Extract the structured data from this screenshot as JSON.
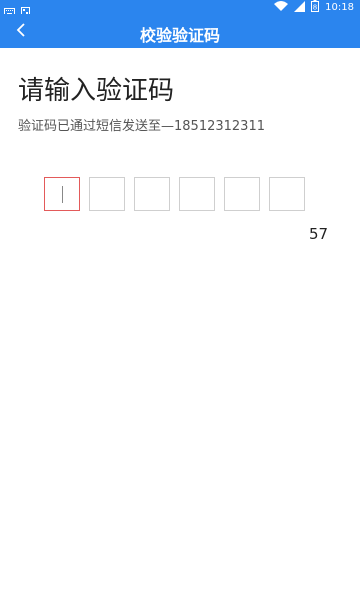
{
  "status_bar": {
    "time": "10:18",
    "battery_level": "8"
  },
  "app_bar": {
    "title": "校验验证码",
    "back_icon": "chevron-left-icon"
  },
  "page": {
    "heading": "请输入验证码",
    "subtitle": "验证码已通过短信发送至—18512312311"
  },
  "code_input": {
    "length": 6,
    "digits": [
      "",
      "",
      "",
      "",
      "",
      ""
    ],
    "active_index": 0
  },
  "countdown": "57",
  "colors": {
    "primary": "#2b85ee",
    "active_border": "#e35a5a",
    "box_border": "#cfcfcf"
  }
}
